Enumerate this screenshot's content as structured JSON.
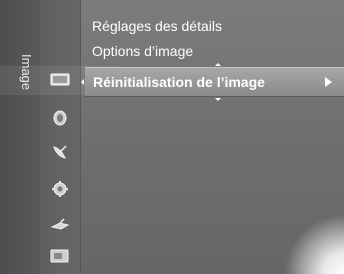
{
  "category": {
    "label": "Image"
  },
  "icons": [
    {
      "name": "picture-icon",
      "active": true
    },
    {
      "name": "sound-icon"
    },
    {
      "name": "channel-icon"
    },
    {
      "name": "setup-gear-icon"
    },
    {
      "name": "input-icon"
    },
    {
      "name": "application-icon"
    }
  ],
  "menu": {
    "items": [
      {
        "label": "Réglages des détails"
      },
      {
        "label": "Options d’image"
      },
      {
        "label": "Réinitialisation de l’image",
        "selected": true,
        "has_submenu": true
      }
    ]
  }
}
